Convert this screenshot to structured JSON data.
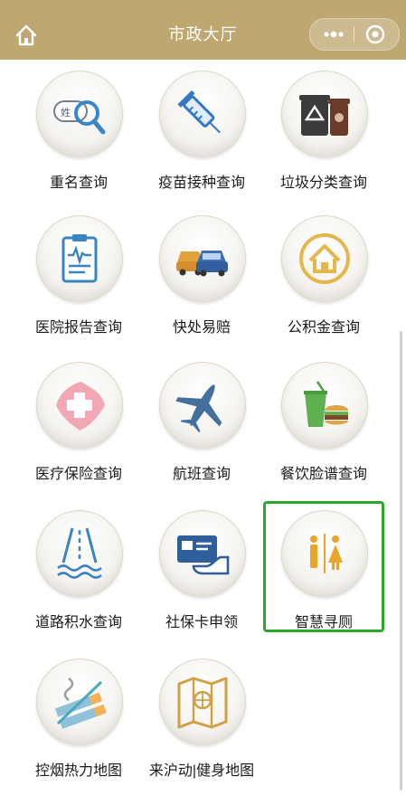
{
  "header": {
    "title": "市政大厅",
    "home_icon": "home-icon",
    "more_icon": "more-dots-icon",
    "close_icon": "close-circle-icon",
    "background_color": "#bfa772"
  },
  "services": [
    {
      "label": "重名查询",
      "icon": "name-search-icon"
    },
    {
      "label": "疫苗接种查询",
      "icon": "vaccine-syringe-icon"
    },
    {
      "label": "垃圾分类查询",
      "icon": "trash-bins-icon"
    },
    {
      "label": "医院报告查询",
      "icon": "medical-report-icon"
    },
    {
      "label": "快处易赔",
      "icon": "car-accident-icon"
    },
    {
      "label": "公积金查询",
      "icon": "housing-fund-icon"
    },
    {
      "label": "医疗保险查询",
      "icon": "medical-insurance-icon"
    },
    {
      "label": "航班查询",
      "icon": "airplane-icon"
    },
    {
      "label": "餐饮脸谱查询",
      "icon": "food-drink-icon"
    },
    {
      "label": "道路积水查询",
      "icon": "road-water-icon"
    },
    {
      "label": "社保卡申领",
      "icon": "social-security-card-icon"
    },
    {
      "label": "智慧寻厕",
      "icon": "restroom-icon"
    },
    {
      "label": "控烟热力地图",
      "icon": "no-smoking-icon"
    },
    {
      "label": "来沪动|健身地图",
      "icon": "fitness-map-icon"
    }
  ],
  "selected_service": "智慧寻厕",
  "highlight_color": "#2ea62e"
}
